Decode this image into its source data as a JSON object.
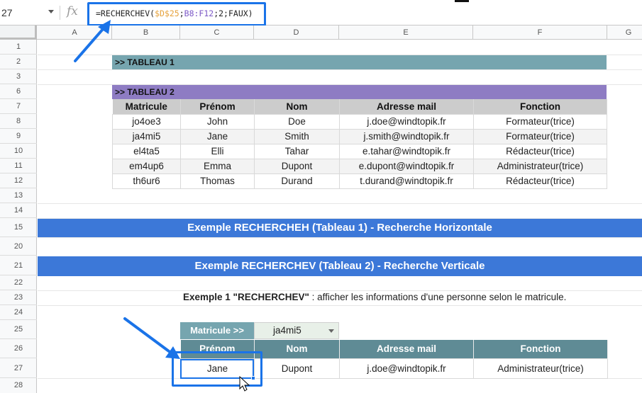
{
  "formula_bar": {
    "cell_ref": "27",
    "fx_label": "fx",
    "formula_parts": [
      "=RECHERCHEV(",
      "$D$25",
      ";",
      "B8:F12",
      ";2;FAUX)"
    ]
  },
  "columns": [
    "A",
    "B",
    "C",
    "D",
    "E",
    "F",
    "G"
  ],
  "rows": [
    "1",
    "2",
    "3",
    "6",
    "7",
    "8",
    "9",
    "10",
    "11",
    "12",
    "13",
    "14",
    "15",
    "20",
    "21",
    "22",
    "23",
    "24",
    "25",
    "26",
    "27",
    "28"
  ],
  "tableau1": {
    "title": ">> TABLEAU 1"
  },
  "tableau2": {
    "title": ">> TABLEAU 2",
    "headers": [
      "Matricule",
      "Prénom",
      "Nom",
      "Adresse mail",
      "Fonction"
    ],
    "rows": [
      [
        "jo4oe3",
        "John",
        "Doe",
        "j.doe@windtopik.fr",
        "Formateur(trice)"
      ],
      [
        "ja4mi5",
        "Jane",
        "Smith",
        "j.smith@windtopik.fr",
        "Formateur(trice)"
      ],
      [
        "el4ta5",
        "Elli",
        "Tahar",
        "e.tahar@windtopik.fr",
        "Rédacteur(trice)"
      ],
      [
        "em4up6",
        "Emma",
        "Dupont",
        "e.dupont@windtopik.fr",
        "Administrateur(trice)"
      ],
      [
        "th6ur6",
        "Thomas",
        "Durand",
        "t.durand@windtopik.fr",
        "Rédacteur(trice)"
      ]
    ]
  },
  "banners": {
    "horizontal": "Exemple RECHERCHEH (Tableau 1) - Recherche Horizontale",
    "vertical": "Exemple RECHERCHEV (Tableau 2) - Recherche Verticale"
  },
  "intro": {
    "bold": "Exemple 1 \"RECHERCHEV\"",
    "rest": " : afficher les informations d'une personne selon le matricule."
  },
  "lookup": {
    "label": "Matricule >>",
    "selected": "ja4mi5",
    "headers": [
      "Prénom",
      "Nom",
      "Adresse mail",
      "Fonction"
    ],
    "result": [
      "Jane",
      "Dupont",
      "j.doe@windtopik.fr",
      "Administrateur(trice)"
    ]
  },
  "colors": {
    "accent_blue": "#1a73e8",
    "banner_blue": "#3c78d8",
    "tableau1_teal": "#76a5af",
    "tableau2_purple": "#8e7cc3",
    "lookup_header": "#5f8b95"
  }
}
